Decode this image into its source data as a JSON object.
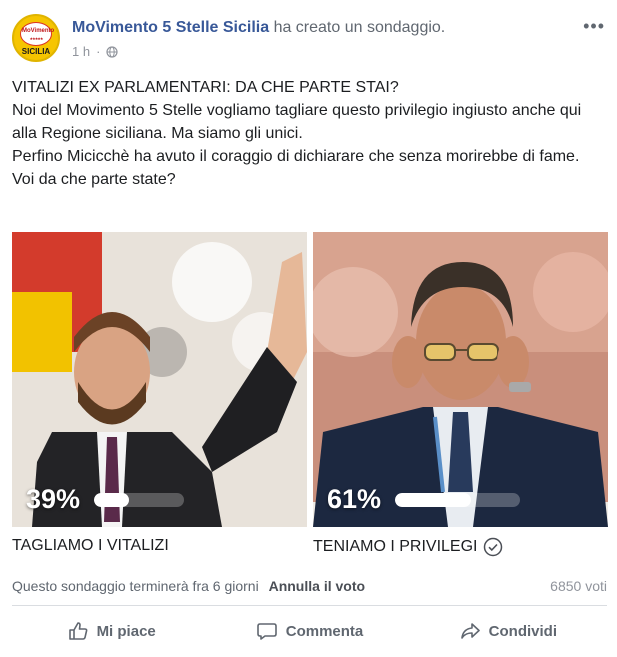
{
  "post": {
    "page_name": "MoVimento 5 Stelle Sicilia",
    "action_text": "ha creato un sondaggio.",
    "time": "1 h",
    "more_label": "•••",
    "avatar": {
      "logo_top": "MoVimento",
      "stars": "★★★★★",
      "region": "SICILIA"
    },
    "text_lines": [
      "VITALIZI EX PARLAMENTARI: DA CHE PARTE STAI?",
      "Noi del Movimento 5 Stelle vogliamo tagliare questo privilegio ingiusto anche qui alla Regione siciliana. Ma siamo gli unici.",
      "Perfino Micicchè ha avuto il coraggio di dichiarare che senza morirebbe di fame.",
      "Voi da che parte state?"
    ]
  },
  "poll": {
    "options": [
      {
        "percent_label": "39%",
        "percent": 39,
        "label": "TAGLIAMO I VITALIZI",
        "voted": false
      },
      {
        "percent_label": "61%",
        "percent": 61,
        "label": "TENIAMO I PRIVILEGI",
        "voted": true
      }
    ],
    "status_text": "Questo sondaggio terminerà fra 6 giorni",
    "cancel_label": "Annulla il voto",
    "votes_label": "6850 voti"
  },
  "actions": {
    "like_label": "Mi piace",
    "comment_label": "Commenta",
    "share_label": "Condividi"
  },
  "colors": {
    "brand": "#385898",
    "muted": "#606770",
    "logo_yellow": "#f6c500",
    "logo_red": "#c0181b"
  }
}
